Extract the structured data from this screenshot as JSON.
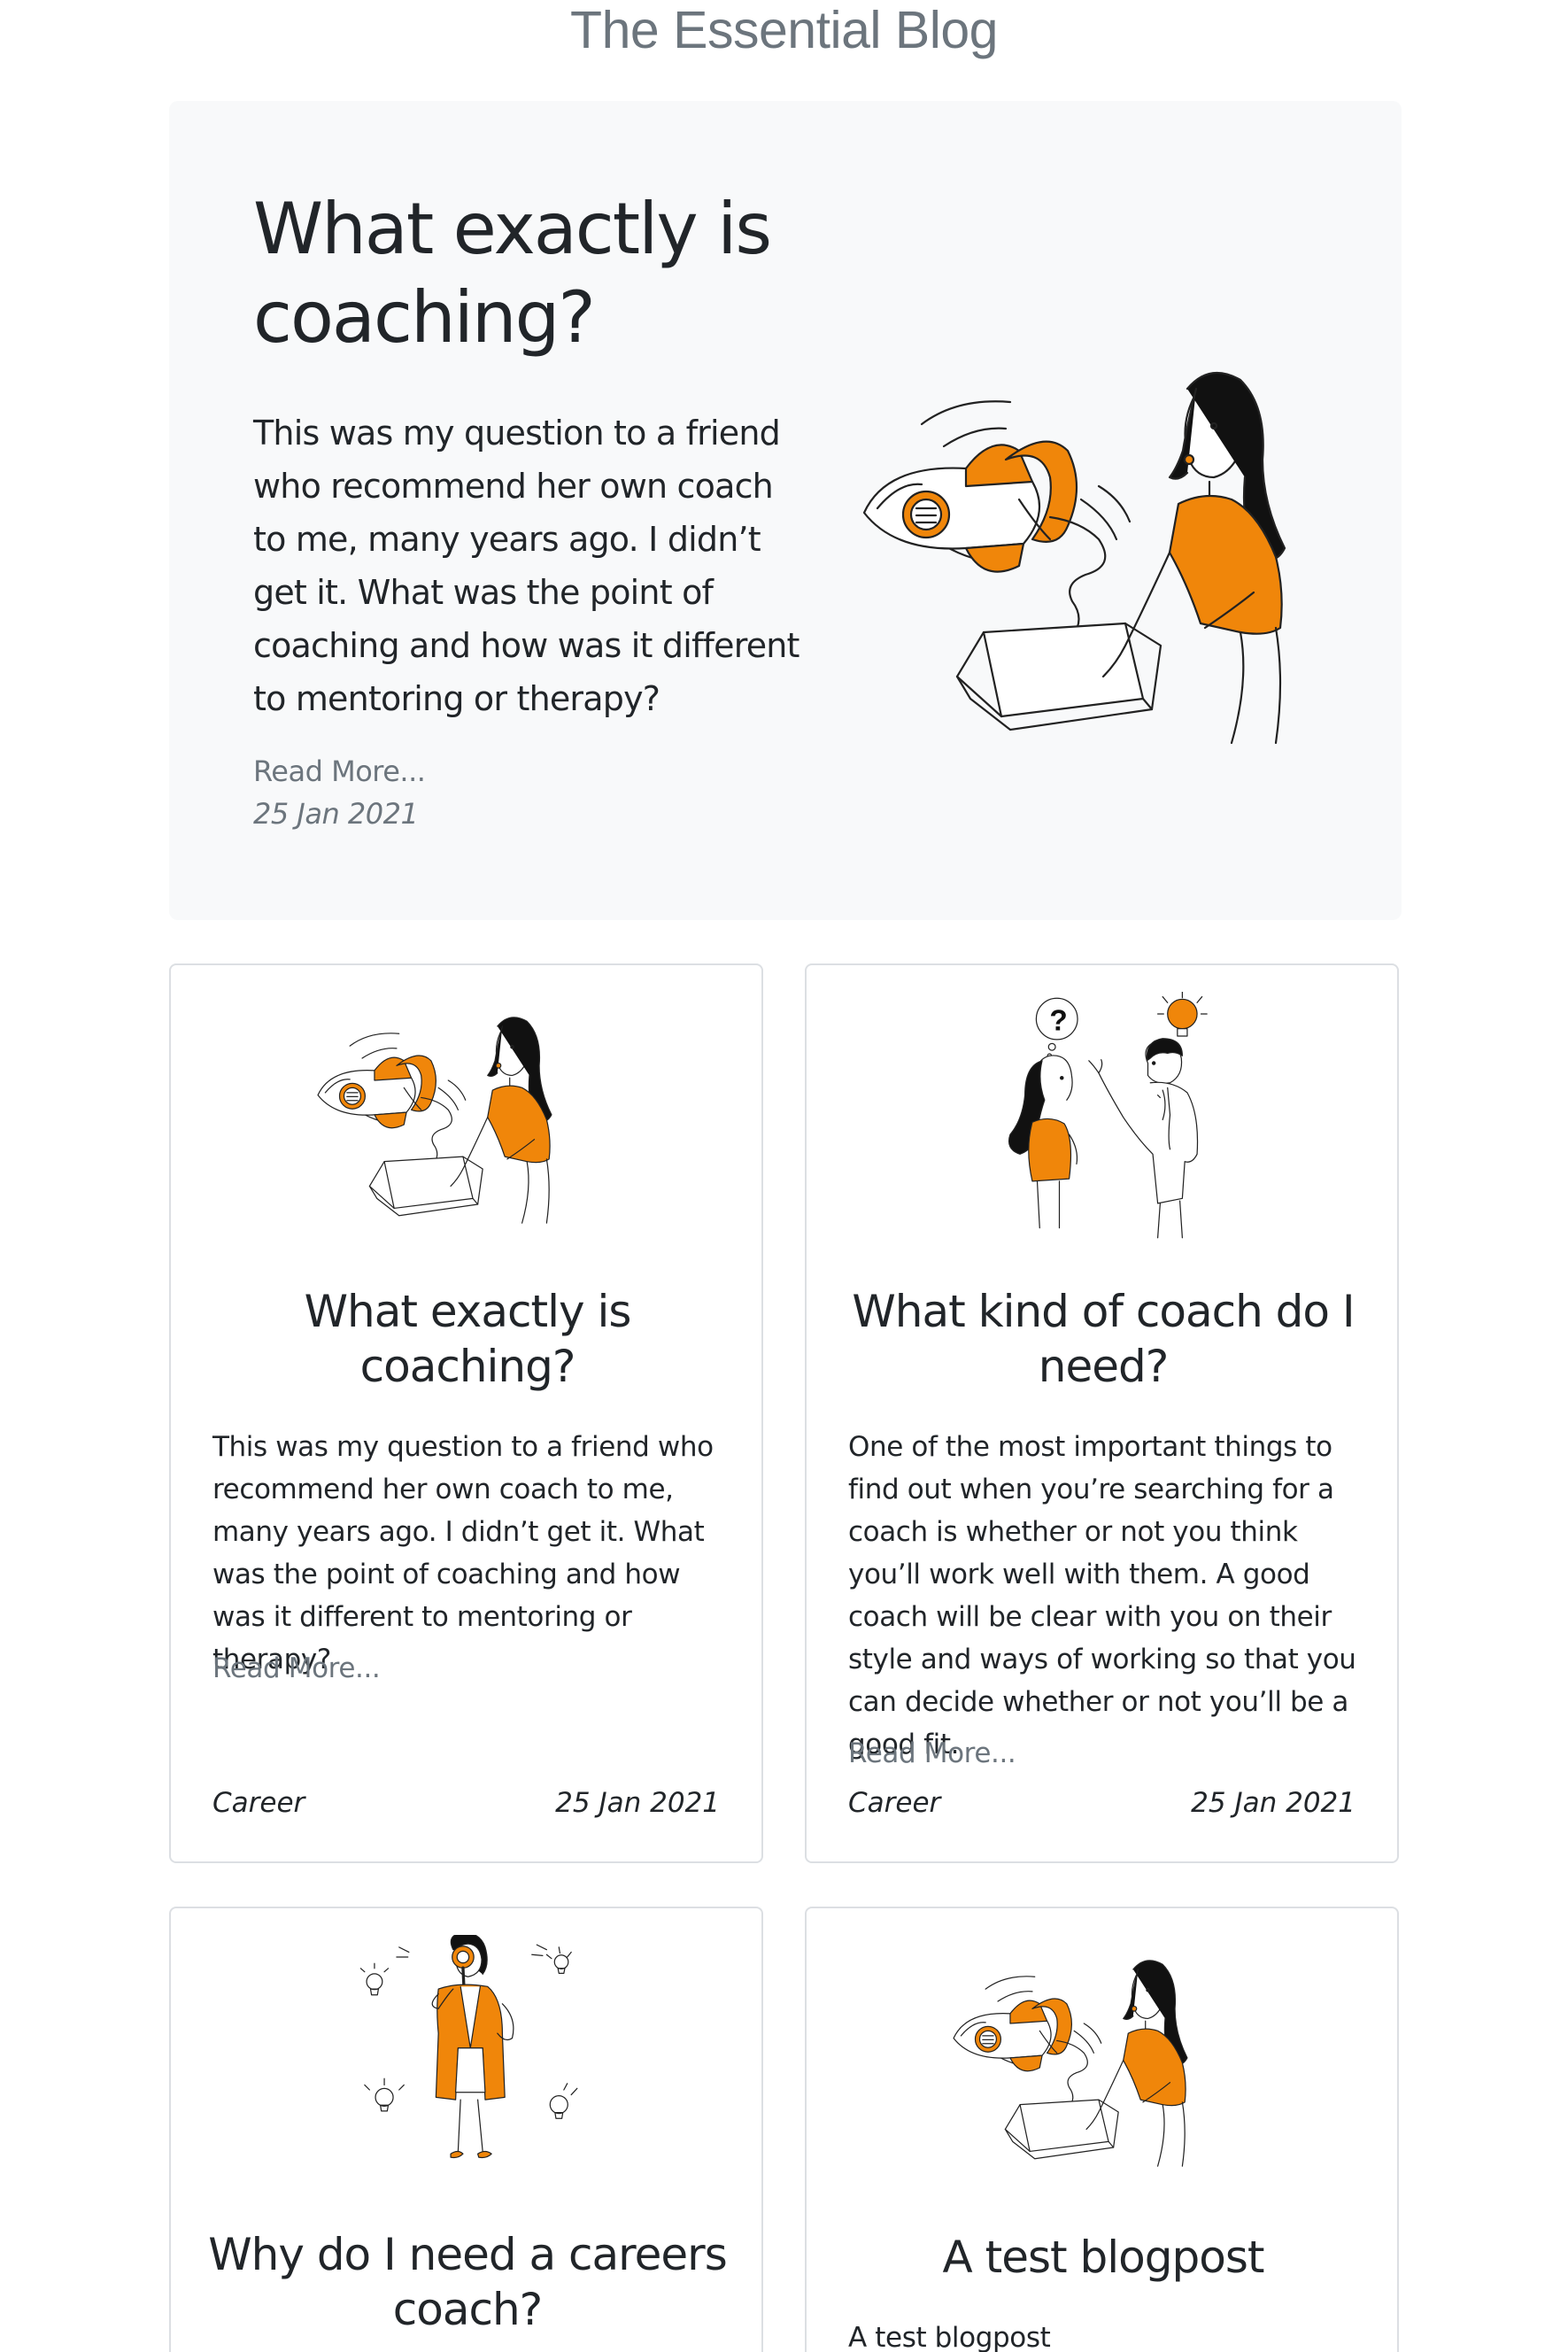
{
  "site": {
    "title": "The Essential Blog"
  },
  "hero": {
    "title": "What exactly is coaching?",
    "excerpt": "This was my question to a friend who recommend her own coach to me, many years ago. I didn’t get it. What was the point of coaching and how was it different to mentoring or therapy?",
    "read_more": "Read More...",
    "date": "25 Jan 2021",
    "illustration": "woman-with-rocket-box-illustration"
  },
  "posts": [
    {
      "title": "What exactly is coaching?",
      "excerpt": "This was my question to a friend who recommend her own coach to me, many years ago. I didn’t get it. What was the point of coaching and how was it different to mentoring or therapy?",
      "read_more": "Read More...",
      "category": "Career",
      "date": "25 Jan 2021",
      "illustration": "woman-with-rocket-box-illustration"
    },
    {
      "title": "What kind of coach do I need?",
      "excerpt": "One of the most important things to find out when you’re searching for a coach is whether or not you think you’ll work well with them. A good coach will be clear with you on their style and ways of working so that you can decide whether or not you’ll be a good fit.",
      "read_more": "Read More...",
      "category": "Career",
      "date": "25 Jan 2021",
      "illustration": "question-and-idea-illustration"
    },
    {
      "title": "Why do I need a careers coach?",
      "excerpt": "",
      "illustration": "woman-with-magnifier-illustration"
    },
    {
      "title": "A test blogpost",
      "excerpt": "A test blogpost",
      "illustration": "woman-with-rocket-box-illustration"
    }
  ],
  "colors": {
    "accent": "#f0860a",
    "muted": "#6c757d",
    "hero_bg": "#f8f9fa",
    "ink": "#212529"
  }
}
